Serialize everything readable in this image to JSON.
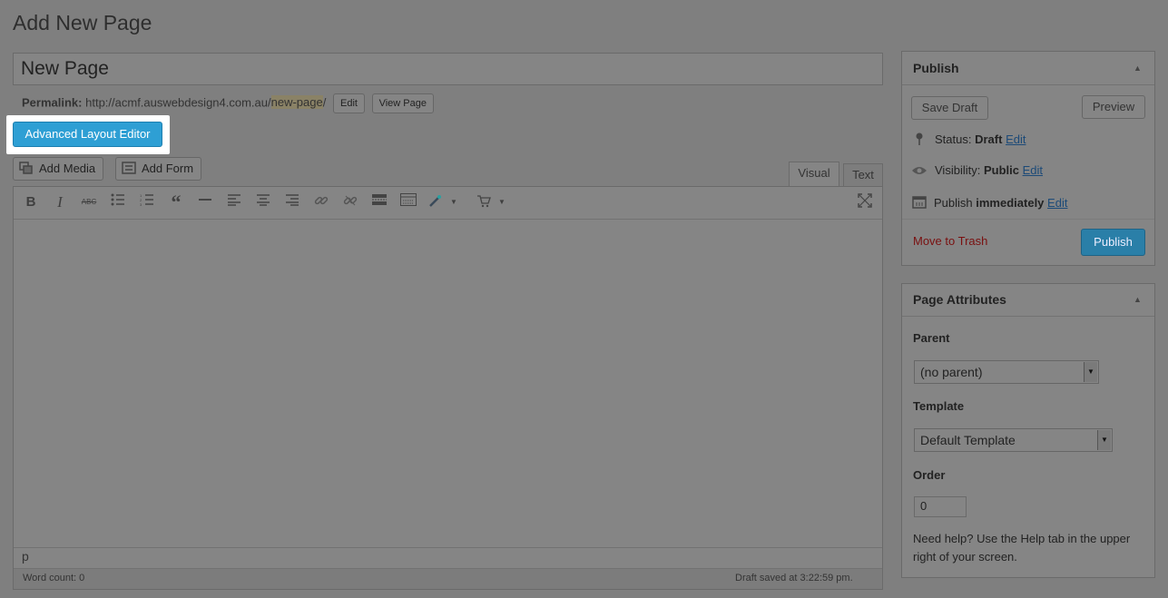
{
  "page": {
    "title": "Add New Page"
  },
  "post": {
    "title_value": "New Page",
    "permalink_label": "Permalink:",
    "permalink_base": "http://acmf.auswebdesign4.com.au/",
    "permalink_slug": "new-page",
    "permalink_trailing": "/",
    "edit_label": "Edit",
    "view_label": "View Page"
  },
  "advanced_layout_editor": {
    "label": "Advanced Layout Editor"
  },
  "media_buttons": {
    "add_media": "Add Media",
    "add_form": "Add Form"
  },
  "editor_tabs": {
    "visual": "Visual",
    "text": "Text",
    "active": "Visual"
  },
  "toolbar": {
    "icons": [
      "bold-icon",
      "italic-icon",
      "strikethrough-icon",
      "bullet-list-icon",
      "numbered-list-icon",
      "blockquote-icon",
      "horizontal-rule-icon",
      "align-left-icon",
      "align-center-icon",
      "align-right-icon",
      "link-icon",
      "unlink-icon",
      "read-more-icon",
      "toolbar-toggle-icon",
      "magic-wand-icon",
      "cart-icon",
      "fullscreen-icon"
    ]
  },
  "editor": {
    "path": "p",
    "word_count": "Word count: 0",
    "draft_saved": "Draft saved at 3:22:59 pm."
  },
  "publish_box": {
    "title": "Publish",
    "save_draft": "Save Draft",
    "preview": "Preview",
    "status_label": "Status:",
    "status_value": "Draft",
    "visibility_label": "Visibility:",
    "visibility_value": "Public",
    "publish_label": "Publish",
    "publish_value": "immediately",
    "edit_link": "Edit",
    "move_to_trash": "Move to Trash",
    "publish_button": "Publish"
  },
  "page_attributes": {
    "title": "Page Attributes",
    "parent_label": "Parent",
    "parent_value": "(no parent)",
    "template_label": "Template",
    "template_value": "Default Template",
    "order_label": "Order",
    "order_value": "0",
    "help_text_1": "Need help? Use the Help tab in the upper",
    "help_text_2": "right of your screen."
  },
  "colors": {
    "accent": "#2e9fd4",
    "overlay": "#7f7f7f",
    "trash": "#7a1010"
  }
}
